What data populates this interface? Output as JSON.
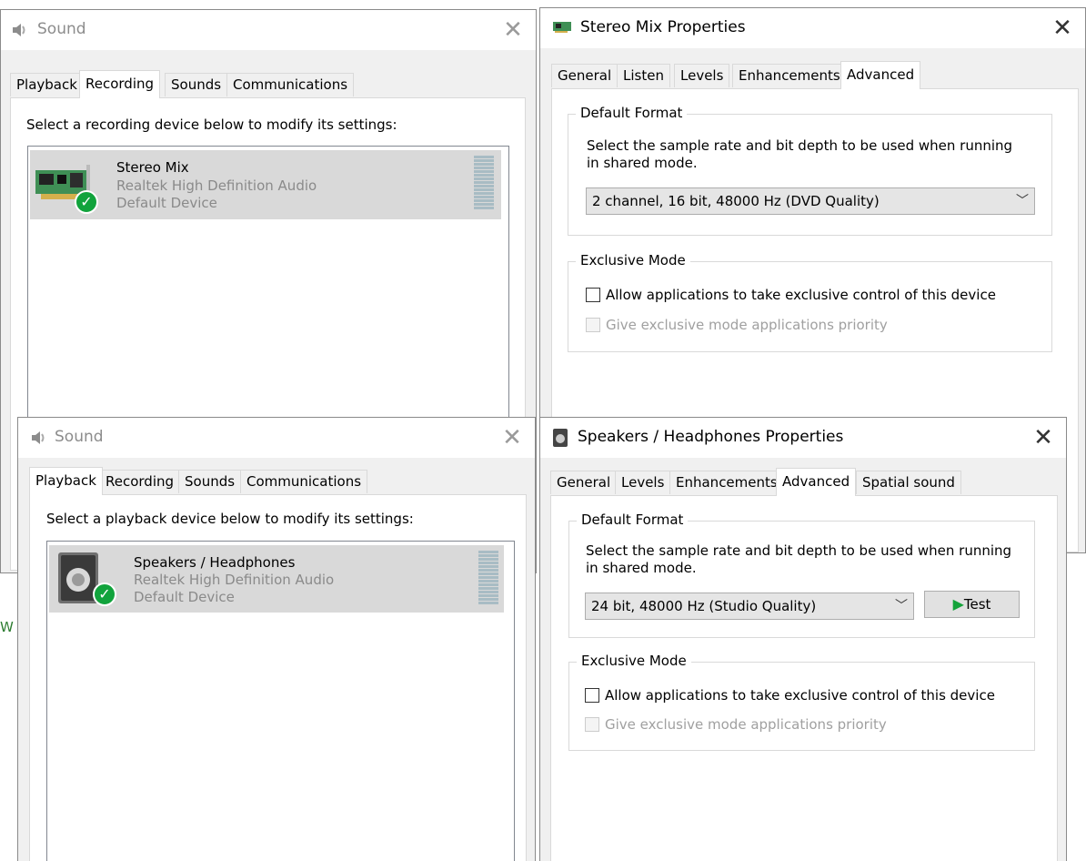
{
  "windows": {
    "sound_recording": {
      "title": "Sound",
      "close_glyph": "✕",
      "tabs": [
        "Playback",
        "Recording",
        "Sounds",
        "Communications"
      ],
      "active_tab": "Recording",
      "prompt": "Select a recording device below to modify its settings:",
      "device": {
        "name": "Stereo Mix",
        "driver": "Realtek High Definition Audio",
        "status": "Default Device",
        "icon": "sound-card-icon"
      }
    },
    "stereo_mix_props": {
      "title": "Stereo Mix Properties",
      "close_glyph": "✕",
      "tabs": [
        "General",
        "Listen",
        "Levels",
        "Enhancements",
        "Advanced"
      ],
      "active_tab": "Advanced",
      "default_format": {
        "legend": "Default Format",
        "description_line1": "Select the sample rate and bit depth to be used when running",
        "description_line2": "in shared mode.",
        "selected": "2 channel, 16 bit, 48000 Hz (DVD Quality)"
      },
      "exclusive_mode": {
        "legend": "Exclusive Mode",
        "allow_label": "Allow applications to take exclusive control of this device",
        "priority_label": "Give exclusive mode applications priority"
      }
    },
    "sound_playback": {
      "title": "Sound",
      "close_glyph": "✕",
      "tabs": [
        "Playback",
        "Recording",
        "Sounds",
        "Communications"
      ],
      "active_tab": "Playback",
      "prompt": "Select a playback device below to modify its settings:",
      "device": {
        "name": "Speakers / Headphones",
        "driver": "Realtek High Definition Audio",
        "status": "Default Device",
        "icon": "speaker-icon"
      }
    },
    "speakers_props": {
      "title": "Speakers / Headphones Properties",
      "close_glyph": "✕",
      "tabs": [
        "General",
        "Levels",
        "Enhancements",
        "Advanced",
        "Spatial sound"
      ],
      "active_tab": "Advanced",
      "default_format": {
        "legend": "Default Format",
        "description_line1": "Select the sample rate and bit depth to be used when running",
        "description_line2": "in shared mode.",
        "selected": "24 bit, 48000 Hz (Studio Quality)",
        "test_label": "Test"
      },
      "exclusive_mode": {
        "legend": "Exclusive Mode",
        "allow_label": "Allow applications to take exclusive control of this device",
        "priority_label": "Give exclusive mode applications priority"
      }
    }
  },
  "colors": {
    "window_bg": "#f0f0f0",
    "selection": "#d9d9d9",
    "default_check": "#11a33c",
    "disabled_text": "#a0a0a0"
  }
}
